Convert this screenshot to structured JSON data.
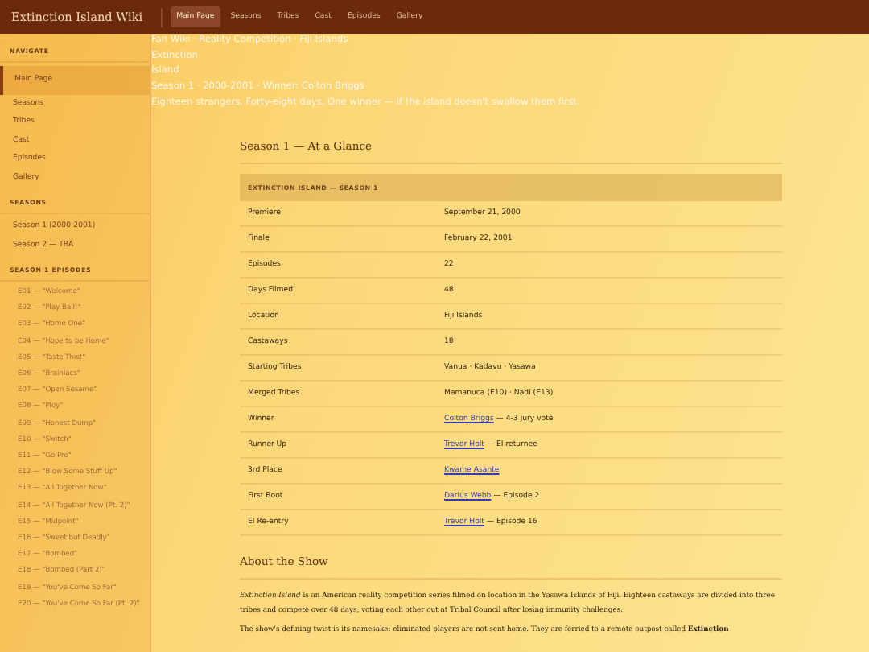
{
  "header": {
    "site_title": "Extinction Island Wiki",
    "nav": [
      {
        "label": "Main Page",
        "selected": true
      },
      {
        "label": "Seasons",
        "selected": false
      },
      {
        "label": "Tribes",
        "selected": false
      },
      {
        "label": "Cast",
        "selected": false
      },
      {
        "label": "Episodes",
        "selected": false
      },
      {
        "label": "Gallery",
        "selected": false
      }
    ]
  },
  "sidebar": {
    "sections": [
      {
        "heading": "NAVIGATE",
        "kind": "nav",
        "items": [
          {
            "label": "Main Page",
            "selected": true
          },
          {
            "label": "Seasons",
            "selected": false
          },
          {
            "label": "Tribes",
            "selected": false
          },
          {
            "label": "Cast",
            "selected": false
          },
          {
            "label": "Episodes",
            "selected": false
          },
          {
            "label": "Gallery",
            "selected": false
          }
        ]
      },
      {
        "heading": "SEASONS",
        "kind": "nav",
        "items": [
          {
            "label": "Season 1 (2000-2001)",
            "selected": false
          },
          {
            "label": "Season 2 — TBA",
            "selected": false
          }
        ]
      },
      {
        "heading": "SEASON 1 EPISODES",
        "kind": "episodes",
        "items": [
          {
            "label": "E01 — \"Welcome\"",
            "selected": false
          },
          {
            "label": "E02 — \"Play Ball!\"",
            "selected": false
          },
          {
            "label": "E03 — \"Home One\"",
            "selected": false
          },
          {
            "label": "E04 — \"Hope to be Home\"",
            "selected": false
          },
          {
            "label": "E05 — \"Taste This!\"",
            "selected": false
          },
          {
            "label": "E06 — \"Brainiacs\"",
            "selected": false
          },
          {
            "label": "E07 — \"Open Sesame\"",
            "selected": false
          },
          {
            "label": "E08 — \"Ploy\"",
            "selected": false
          },
          {
            "label": "E09 — \"Honest Dump\"",
            "selected": false
          },
          {
            "label": "E10 — \"Switch\"",
            "selected": false
          },
          {
            "label": "E11 — \"Go Pro\"",
            "selected": false
          },
          {
            "label": "E12 — \"Blow Some Stuff Up\"",
            "selected": false
          },
          {
            "label": "E13 — \"All Together Now\"",
            "selected": false
          },
          {
            "label": "E14 — \"All Together Now (Pt. 2)\"",
            "selected": false
          },
          {
            "label": "E15 — \"Midpoint\"",
            "selected": false
          },
          {
            "label": "E16 — \"Sweet but Deadly\"",
            "selected": false
          },
          {
            "label": "E17 — \"Bombed\"",
            "selected": false
          },
          {
            "label": "E18 — \"Bombed (Part 2)\"",
            "selected": false
          },
          {
            "label": "E19 — \"You've Come So Far\"",
            "selected": false
          },
          {
            "label": "E20 — \"You've Come So Far (Pt. 2)\"",
            "selected": false
          }
        ]
      }
    ]
  },
  "hero": {
    "breadcrumb": "Fan Wiki · Reality Competition · Fiji Islands",
    "title": "Extinction Island",
    "meta": "Season 1 · 2000-2001 · Winner: Colton Briggs",
    "tagline": "Eighteen strangers. Forty-eight days. One winner — if the island doesn't swallow them first."
  },
  "glance": {
    "heading": "Season 1 — At a Glance",
    "table_title": "EXTINCTION ISLAND — SEASON 1",
    "rows": [
      {
        "label": "Premiere",
        "value": "September 21, 2000"
      },
      {
        "label": "Finale",
        "value": "February 22, 2001"
      },
      {
        "label": "Episodes",
        "value": "22"
      },
      {
        "label": "Days Filmed",
        "value": "48"
      },
      {
        "label": "Location",
        "value": "Fiji Islands"
      },
      {
        "label": "Castaways",
        "value": "18"
      },
      {
        "label": "Starting Tribes",
        "value": "Vanua · Kadavu · Yasawa"
      },
      {
        "label": "Merged Tribes",
        "value": "Mamanuca (E10) · Nadi (E13)"
      },
      {
        "label": "Winner",
        "link": "Colton Briggs",
        "value": "— 4-3 jury vote"
      },
      {
        "label": "Runner-Up",
        "link": "Trevor Holt",
        "value": "— EI returnee"
      },
      {
        "label": "3rd Place",
        "link": "Kwame Asante"
      },
      {
        "label": "First Boot",
        "link": "Darius Webb",
        "value": "— Episode 2"
      },
      {
        "label": "EI Re-entry",
        "link": "Trevor Holt",
        "value": "— Episode 16"
      }
    ]
  },
  "about": {
    "heading": "About the Show",
    "paragraphs": [
      "*Extinction Island* is an American reality competition series filmed on location in the Yasawa Islands of Fiji. Eighteen castaways are divided into three tribes and compete over 48 days, voting each other out at Tribal Council after losing immunity challenges.",
      "The show's defining twist is its namesake: eliminated players are not sent home. They are ferried to a remote outpost called **Extinction**"
    ]
  }
}
